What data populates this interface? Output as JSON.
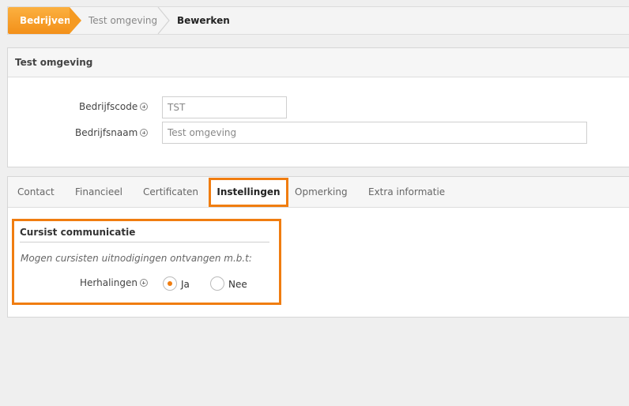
{
  "breadcrumb": {
    "items": [
      "Bedrijven",
      "Test omgeving",
      "Bewerken"
    ]
  },
  "company_panel": {
    "title": "Test omgeving",
    "fields": {
      "code_label": "Bedrijfscode",
      "code_value": "TST",
      "name_label": "Bedrijfsnaam",
      "name_value": "Test omgeving"
    }
  },
  "tabs": {
    "items": [
      "Contact",
      "Financieel",
      "Certificaten",
      "Instellingen",
      "Opmerking",
      "Extra informatie"
    ],
    "active": "Instellingen"
  },
  "settings": {
    "section_title": "Cursist communicatie",
    "description": "Mogen cursisten uitnodigingen ontvangen m.b.t:",
    "field_label": "Herhalingen",
    "options": [
      "Ja",
      "Nee"
    ],
    "selected": "Ja"
  },
  "colors": {
    "accent": "#f07d10",
    "breadcrumb_active": "#f59a22"
  }
}
